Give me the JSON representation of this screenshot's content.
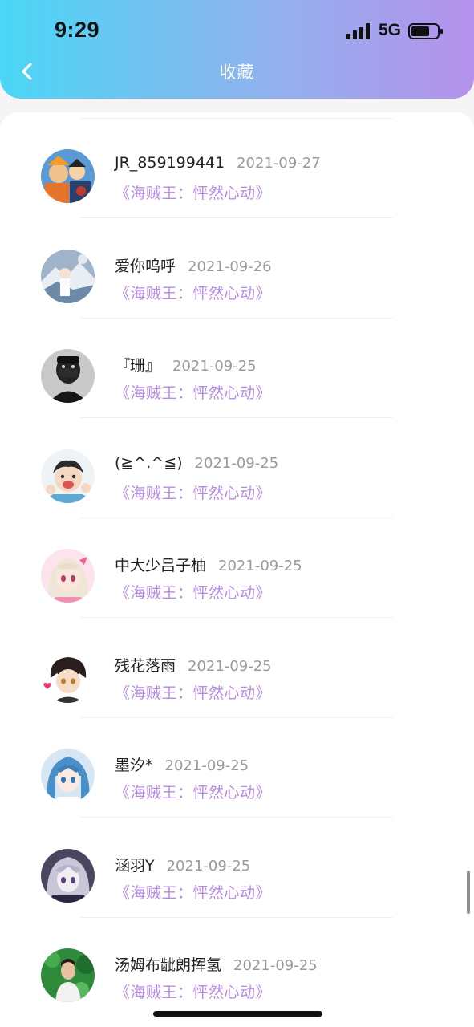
{
  "status_bar": {
    "time": "9:29",
    "network": "5G"
  },
  "nav": {
    "title": "收藏",
    "back_icon": "chevron-left-icon"
  },
  "colors": {
    "header_gradient": [
      "#4ad6f5",
      "#8fb3ee",
      "#b592ec"
    ],
    "book_title": "#b88ae6",
    "date": "#9a9a9a"
  },
  "favorites": [
    {
      "username": "JR_859199441",
      "date": "2021-09-27",
      "book": "《海贼王：怦然心动》",
      "avatar": "anime-group-avatar"
    },
    {
      "username": "爱你呜呼",
      "date": "2021-09-26",
      "book": "《海贼王：怦然心动》",
      "avatar": "scenery-avatar"
    },
    {
      "username": "『珊』",
      "date": "2021-09-25",
      "book": "《海贼王：怦然心动》",
      "avatar": "masked-person-avatar"
    },
    {
      "username": "(≧^.^≦)",
      "date": "2021-09-25",
      "book": "《海贼王：怦然心动》",
      "avatar": "cartoon-kid-avatar"
    },
    {
      "username": "中大少吕子柚",
      "date": "2021-09-25",
      "book": "《海贼王：怦然心动》",
      "avatar": "anime-girl-pink-avatar"
    },
    {
      "username": "残花落雨",
      "date": "2021-09-25",
      "book": "《海贼王：怦然心动》",
      "avatar": "anime-boy-avatar"
    },
    {
      "username": "墨汐*",
      "date": "2021-09-25",
      "book": "《海贼王：怦然心动》",
      "avatar": "anime-girl-blue-avatar"
    },
    {
      "username": "涵羽Y",
      "date": "2021-09-25",
      "book": "《海贼王：怦然心动》",
      "avatar": "anime-girl-dark-avatar"
    },
    {
      "username": "汤姆布龇朗挥氢",
      "date": "2021-09-25",
      "book": "《海贼王：怦然心动》",
      "avatar": "green-photo-avatar"
    }
  ]
}
